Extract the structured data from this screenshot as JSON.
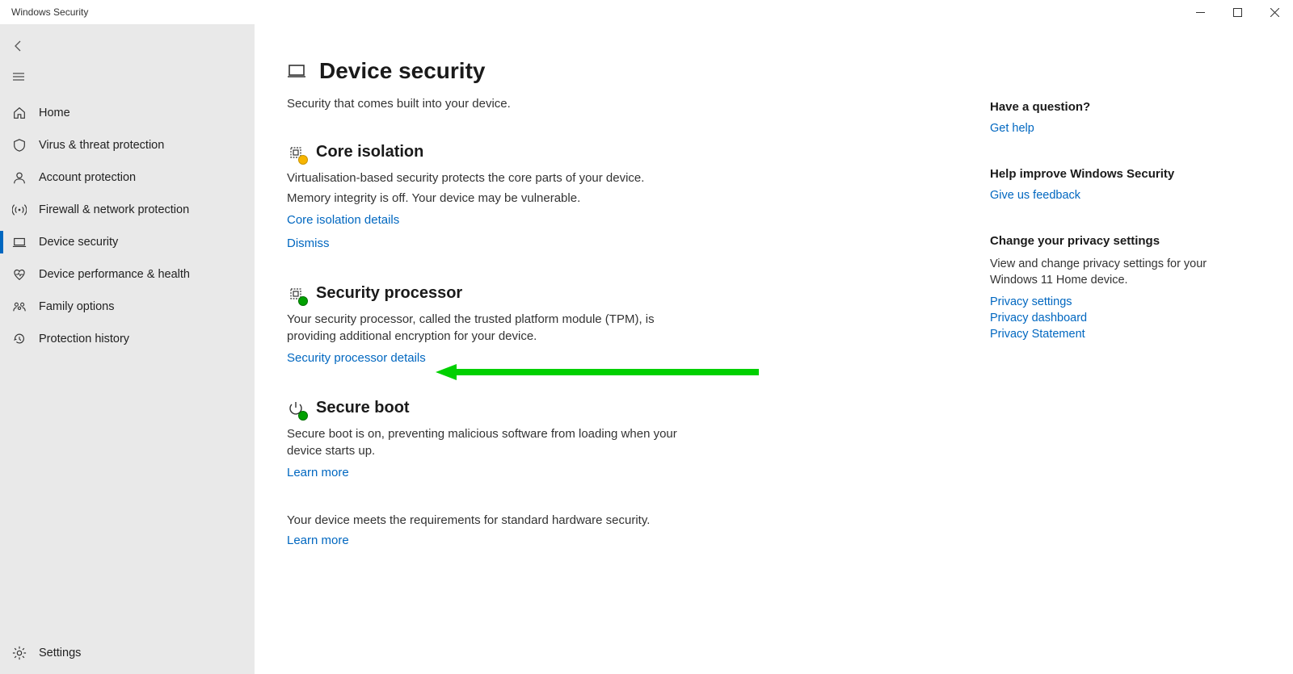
{
  "window": {
    "title": "Windows Security"
  },
  "sidebar": {
    "items": [
      {
        "id": "home",
        "label": "Home"
      },
      {
        "id": "virus",
        "label": "Virus & threat protection"
      },
      {
        "id": "account",
        "label": "Account protection"
      },
      {
        "id": "firewall",
        "label": "Firewall & network protection"
      },
      {
        "id": "device",
        "label": "Device security"
      },
      {
        "id": "performance",
        "label": "Device performance & health"
      },
      {
        "id": "family",
        "label": "Family options"
      },
      {
        "id": "history",
        "label": "Protection history"
      }
    ],
    "settings": "Settings"
  },
  "page": {
    "title": "Device security",
    "subtitle": "Security that comes built into your device.",
    "sections": {
      "core": {
        "title": "Core isolation",
        "line1": "Virtualisation-based security protects the core parts of your device.",
        "line2": "Memory integrity is off. Your device may be vulnerable.",
        "link": "Core isolation details",
        "dismiss": "Dismiss"
      },
      "tpm": {
        "title": "Security processor",
        "desc": "Your security processor, called the trusted platform module (TPM), is providing additional encryption for your device.",
        "link": "Security processor details"
      },
      "secureboot": {
        "title": "Secure boot",
        "desc": "Secure boot is on, preventing malicious software from loading when your device starts up.",
        "link": "Learn more"
      },
      "footer": {
        "text": "Your device meets the requirements for standard hardware security.",
        "link": "Learn more"
      }
    }
  },
  "aside": {
    "question": {
      "title": "Have a question?",
      "link": "Get help"
    },
    "improve": {
      "title": "Help improve Windows Security",
      "link": "Give us feedback"
    },
    "privacy": {
      "title": "Change your privacy settings",
      "desc": "View and change privacy settings for your Windows 11 Home device.",
      "links": [
        "Privacy settings",
        "Privacy dashboard",
        "Privacy Statement"
      ]
    }
  },
  "colors": {
    "link": "#0067c0",
    "warn": "#f7b500",
    "ok": "#00a000",
    "arrow": "#00d000"
  }
}
